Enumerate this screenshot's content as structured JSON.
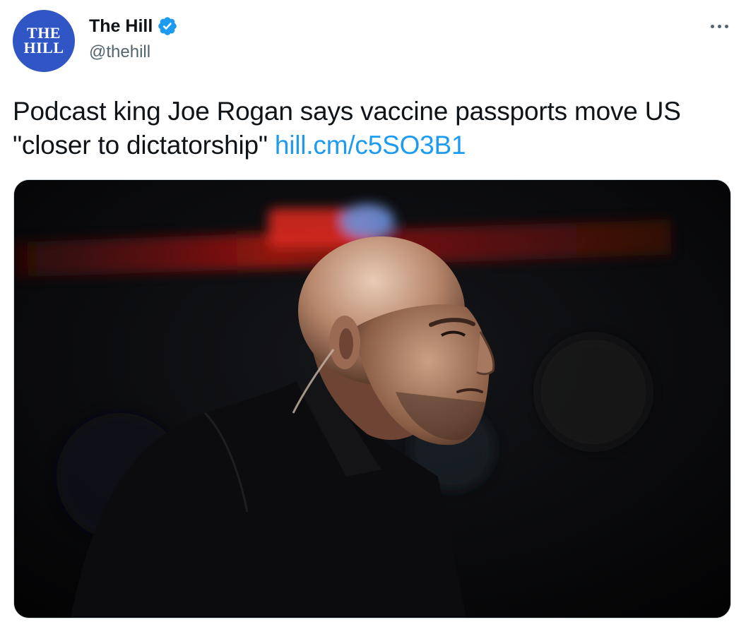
{
  "account": {
    "avatar_text_line1": "THE",
    "avatar_text_line2": "HILL",
    "display_name": "The Hill",
    "handle": "@thehill",
    "verified": true,
    "avatar_color": "#2f56c4",
    "verified_color": "#1d9bf0"
  },
  "tweet": {
    "text": "Podcast king Joe Rogan says vaccine passports move US \"closer to dictatorship\"",
    "link_text": "hill.cm/c5SO3B1",
    "link_color": "#1d9bf0"
  },
  "media": {
    "icon": "photo"
  },
  "menu": {
    "icon": "more-horizontal-icon"
  }
}
